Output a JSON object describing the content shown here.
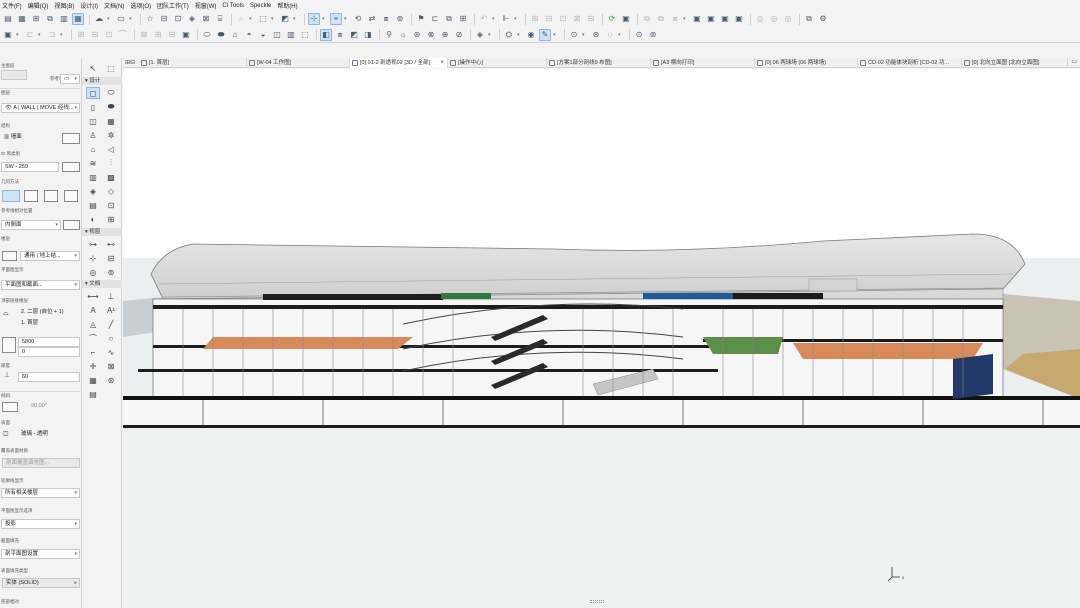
{
  "menu": [
    "文件(F)",
    "编辑(Q)",
    "视图(B)",
    "设计(I)",
    "文档(N)",
    "选项(O)",
    "团队工作(T)",
    "视窗(W)",
    "CI Tools",
    "Speckle",
    "帮助(H)"
  ],
  "tabs": [
    {
      "label": "[1. 首层]"
    },
    {
      "label": "[W-04 工作图]"
    },
    {
      "label": "[0] 01-2 剖透视02 [3D / 全部]",
      "close": "×"
    },
    {
      "label": "[操作中心]"
    },
    {
      "label": "[方案1部分剖线9 布图]"
    },
    {
      "label": "[A3 横向打印]"
    },
    {
      "label": "[0] 06 两球场 (06 两球场)"
    },
    {
      "label": "CD-02 功能体块剖析 [CD-02 功..."
    },
    {
      "label": "[0] 北向立面图 [北向立面图]"
    }
  ],
  "info": {
    "label_main_layer": "主图层",
    "label_ref_line": "参考线位置",
    "label_layer": "图层",
    "layer_value": "A | WALL | MOVE:经线...",
    "label_struct": "结构",
    "struct_value": "墙面",
    "label_id": "ID 和类别",
    "id_value": "SW - 259",
    "label_geom": "几何方法",
    "label_ref_plane": "参考线相对位置",
    "ref_plane_value": "内侧面",
    "label_floor": "楼层",
    "floor_value": "通用 | 地上结...",
    "label_plan_display": "平面图显示",
    "plan_display_value": "平面图和截面...",
    "label_top_link": "顶部链接楼层",
    "top_link_value": "2. 二层 (自位 + 1)",
    "label_home_story": "原点楼层",
    "home_story_value": "1. 首层",
    "label_height": "高度",
    "height_value": "5800",
    "offset_value": "0",
    "label_thickness": "厚度",
    "thickness_value": "60",
    "label_slant": "倾斜",
    "slant_value": "90.00°",
    "label_surface": "表面",
    "surface_value": "玻璃 - 透明",
    "label_override": "覆盖表面材质",
    "override_value": "剖面覆盖填充图...",
    "label_outline": "轮廓线显示",
    "outline_value": "所有相关楼层",
    "label_line_type": "平面图显示选项",
    "line_type_value": "投影",
    "label_cut_fill": "截面填充",
    "cut_fill_value": "剖平面图设置",
    "label_surface_fill": "表面填充类型",
    "surface_fill_value": "实体 (SOLID)",
    "label_bottom": "底部相对"
  },
  "toolbox": {
    "group_design": "设计",
    "group_view": "视窗",
    "group_document": "文档"
  },
  "icons": {
    "accent": "#2f6fb6",
    "active_bg": "#cfe3f6"
  }
}
